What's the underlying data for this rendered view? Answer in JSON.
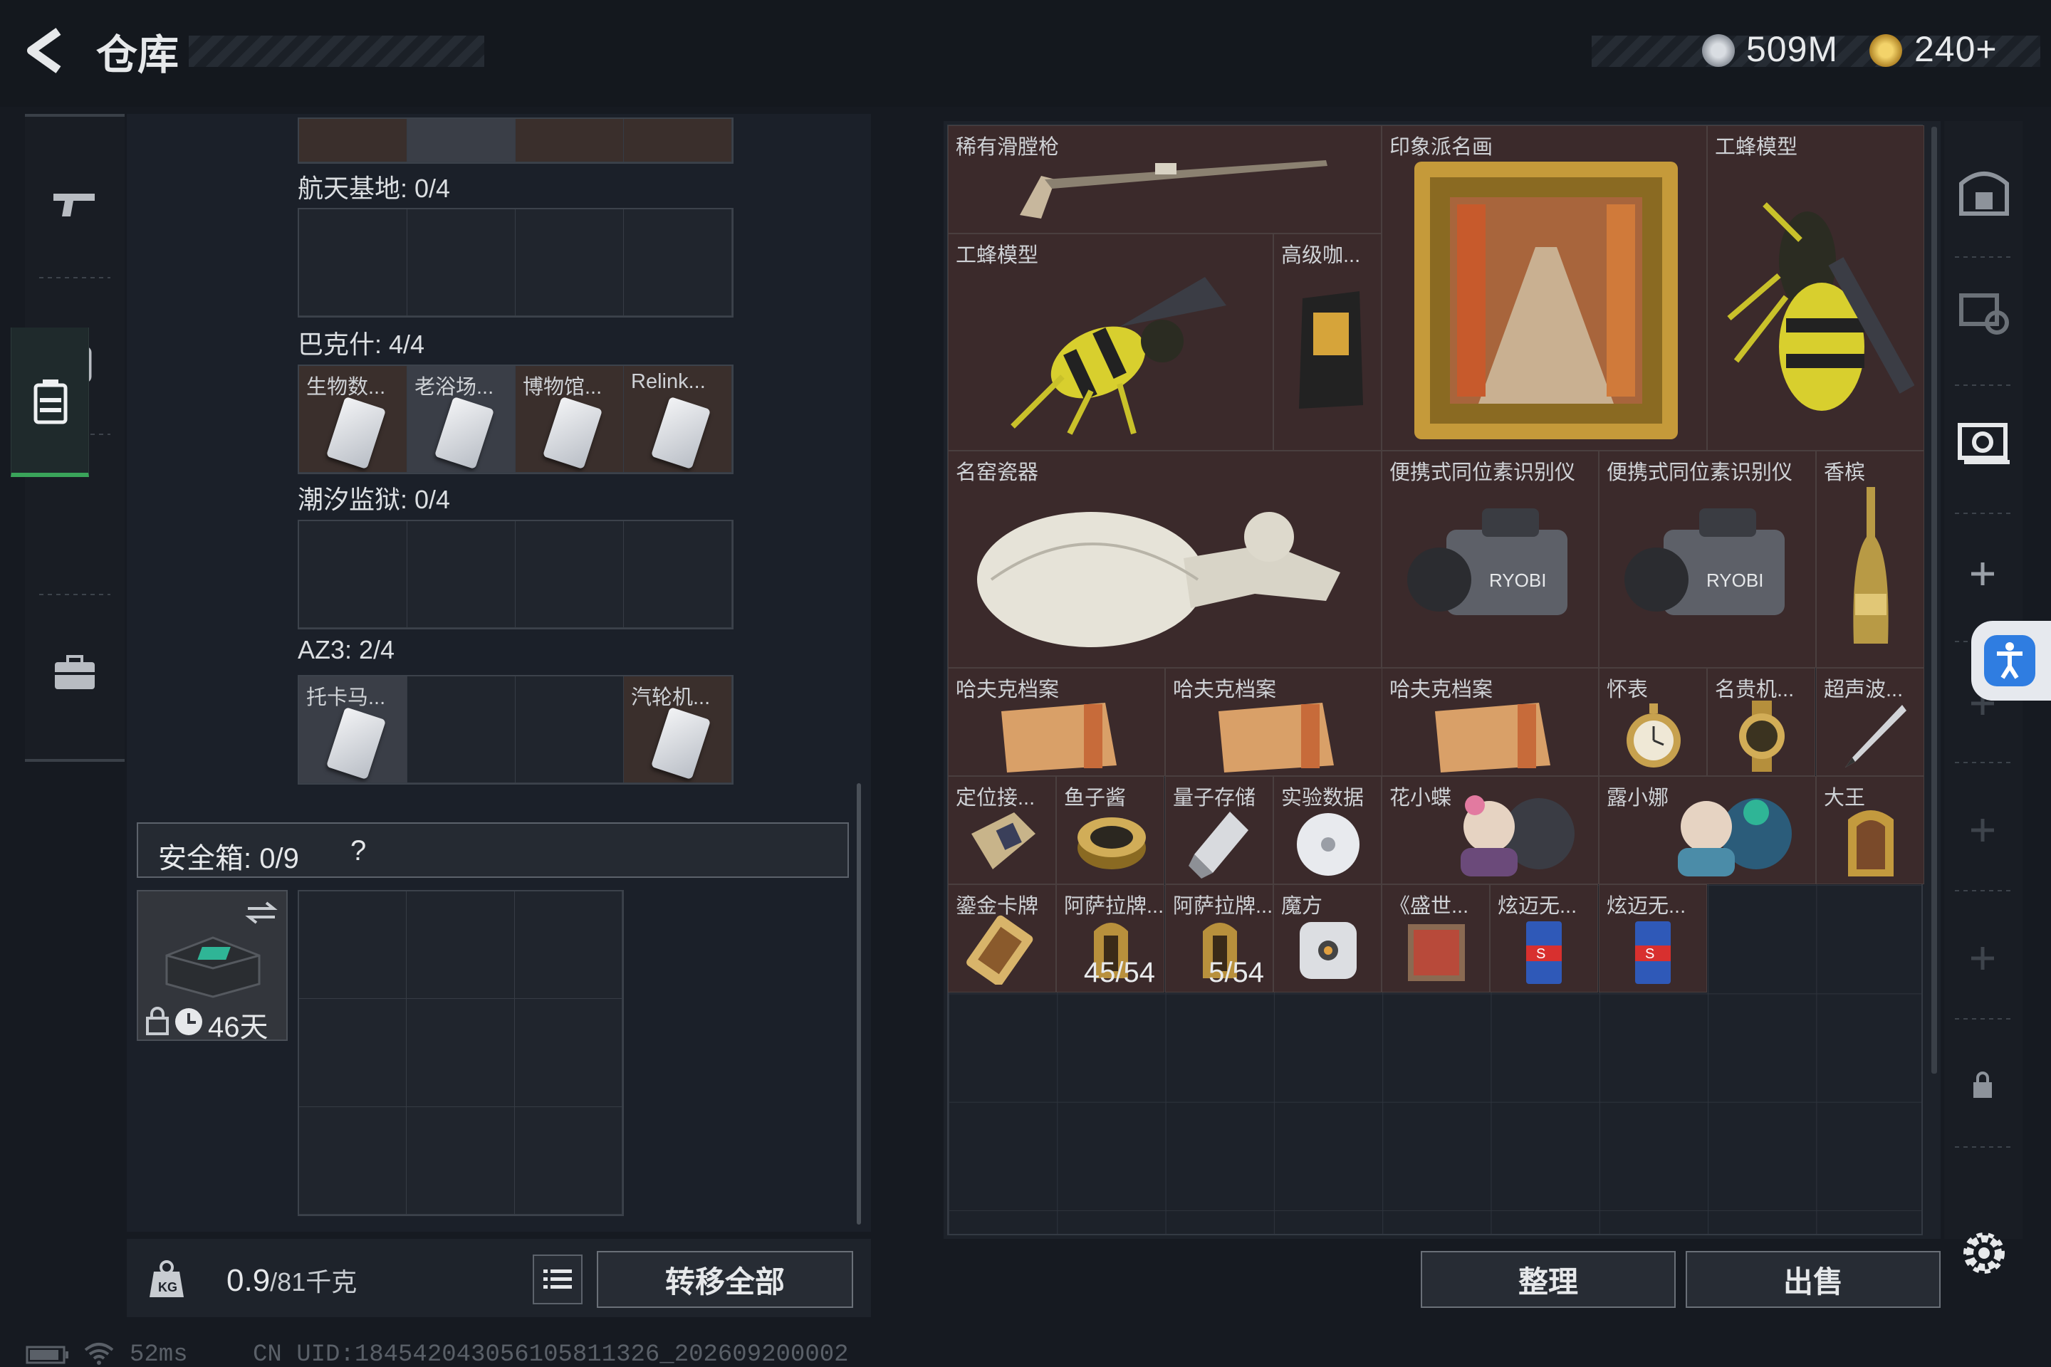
{
  "header": {
    "title": "仓库",
    "currency_1": "509M",
    "currency_2": "240+"
  },
  "left": {
    "sections": [
      {
        "title": "航天基地: 0/4"
      },
      {
        "title": "巴克什: 4/4",
        "items": [
          "生物数...",
          "老浴场...",
          "博物馆...",
          "Relink..."
        ]
      },
      {
        "title": "潮汐监狱: 0/4"
      },
      {
        "title": "AZ3: 2/4",
        "items": [
          "托卡马...",
          "汽轮机..."
        ]
      }
    ],
    "safe_label": "安全箱: 0/9",
    "safe_help": "?",
    "safe_days": "46天",
    "weight_value": "0.9",
    "weight_max": "/81千克",
    "transfer_all": "转移全部"
  },
  "items": [
    {
      "label": "稀有滑膛枪",
      "icon": "musket-icon"
    },
    {
      "label": "印象派名画",
      "icon": "painting-icon"
    },
    {
      "label": "工蜂模型",
      "icon": "bee-model-icon"
    },
    {
      "label": "工蜂模型",
      "icon": "bee-model-icon"
    },
    {
      "label": "高级咖...",
      "icon": "coffee-bag-icon"
    },
    {
      "label": "名窑瓷器",
      "icon": "porcelain-icon"
    },
    {
      "label": "便携式同位素识别仪",
      "icon": "isotope-scanner-icon"
    },
    {
      "label": "便携式同位素识别仪",
      "icon": "isotope-scanner-icon"
    },
    {
      "label": "香槟",
      "icon": "champagne-icon"
    },
    {
      "label": "哈夫克档案",
      "icon": "file-folder-icon"
    },
    {
      "label": "哈夫克档案",
      "icon": "file-folder-icon"
    },
    {
      "label": "哈夫克档案",
      "icon": "file-folder-icon"
    },
    {
      "label": "怀表",
      "icon": "pocket-watch-icon"
    },
    {
      "label": "名贵机...",
      "icon": "luxury-watch-icon"
    },
    {
      "label": "超声波...",
      "icon": "ultrasonic-pen-icon"
    },
    {
      "label": "定位接...",
      "icon": "locator-icon"
    },
    {
      "label": "鱼子酱",
      "icon": "caviar-icon"
    },
    {
      "label": "量子存储",
      "icon": "usb-drive-icon"
    },
    {
      "label": "实验数据",
      "icon": "disc-icon"
    },
    {
      "label": "花小蝶",
      "icon": "figure-icon"
    },
    {
      "label": "露小娜",
      "icon": "figure-icon"
    },
    {
      "label": "大王",
      "icon": "plaque-icon"
    },
    {
      "label": "鎏金卡牌",
      "icon": "gold-card-icon"
    },
    {
      "label": "阿萨拉牌...",
      "icon": "token-icon",
      "count": "45/54"
    },
    {
      "label": "阿萨拉牌...",
      "icon": "token-icon",
      "count": "5/54"
    },
    {
      "label": "魔方",
      "icon": "cube-icon"
    },
    {
      "label": "《盛世...",
      "icon": "book-icon"
    },
    {
      "label": "炫迈无...",
      "icon": "gum-icon"
    },
    {
      "label": "炫迈无...",
      "icon": "gum-icon"
    }
  ],
  "buttons": {
    "sort": "整理",
    "sell": "出售"
  },
  "status": {
    "ping": "52ms",
    "uid": "CN UID:1845420430561058113​26_202609200002"
  },
  "colors": {
    "item_bg": "#3b2a2b",
    "accent_green": "#3aa45a",
    "accessibility_blue": "#2f7de1"
  }
}
